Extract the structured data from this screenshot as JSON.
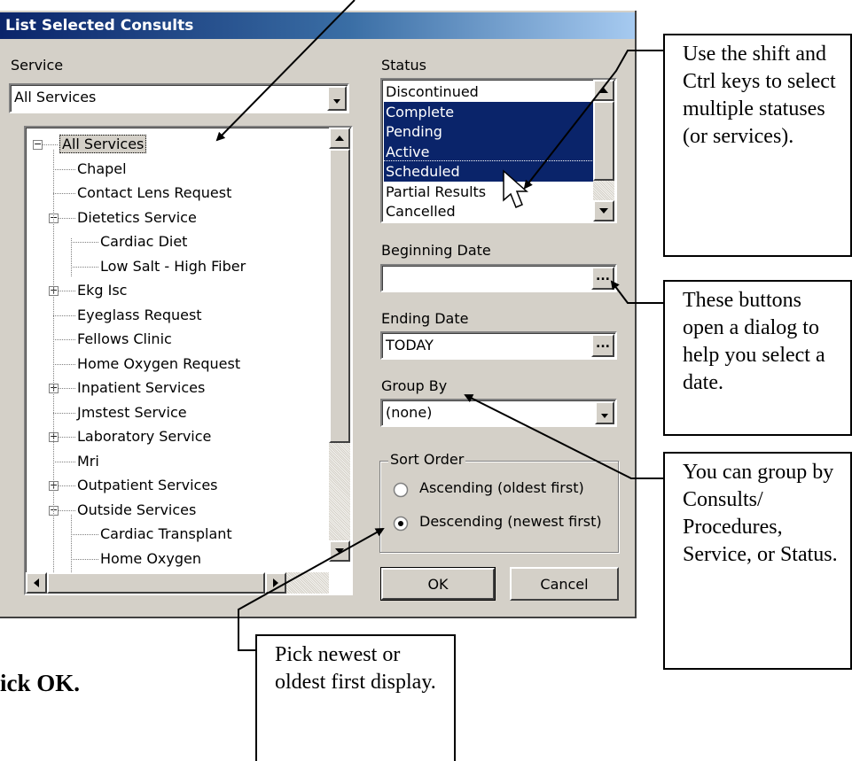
{
  "dialog": {
    "title": "List Selected Consults",
    "service": {
      "label": "Service",
      "value": "All Services",
      "tree": [
        {
          "label": "All Services",
          "level": 0,
          "expander": "−",
          "selected": true
        },
        {
          "label": "Chapel",
          "level": 1
        },
        {
          "label": "Contact Lens Request",
          "level": 1
        },
        {
          "label": "Dietetics Service",
          "level": 1,
          "expander": "−"
        },
        {
          "label": "Cardiac Diet",
          "level": 2
        },
        {
          "label": "Low Salt - High Fiber",
          "level": 2
        },
        {
          "label": "Ekg Isc",
          "level": 1,
          "expander": "+"
        },
        {
          "label": "Eyeglass Request",
          "level": 1
        },
        {
          "label": "Fellows Clinic",
          "level": 1
        },
        {
          "label": "Home Oxygen Request",
          "level": 1
        },
        {
          "label": "Inpatient Services",
          "level": 1,
          "expander": "+"
        },
        {
          "label": "Jmstest Service",
          "level": 1
        },
        {
          "label": "Laboratory Service",
          "level": 1,
          "expander": "+"
        },
        {
          "label": "Mri",
          "level": 1
        },
        {
          "label": "Outpatient Services",
          "level": 1,
          "expander": "+"
        },
        {
          "label": "Outside Services",
          "level": 1,
          "expander": "−"
        },
        {
          "label": "Cardiac Transplant",
          "level": 2
        },
        {
          "label": "Home Oxygen",
          "level": 2
        }
      ]
    },
    "status": {
      "label": "Status",
      "items": [
        {
          "label": "Discontinued",
          "selected": false
        },
        {
          "label": "Complete",
          "selected": true
        },
        {
          "label": "Pending",
          "selected": true
        },
        {
          "label": "Active",
          "selected": true
        },
        {
          "label": "Scheduled",
          "selected": true
        },
        {
          "label": "Partial Results",
          "selected": false
        },
        {
          "label": "Cancelled",
          "selected": false
        }
      ]
    },
    "beginning_date": {
      "label": "Beginning Date",
      "value": "",
      "button": "..."
    },
    "ending_date": {
      "label": "Ending Date",
      "value": "TODAY",
      "button": "..."
    },
    "group_by": {
      "label": "Group By",
      "value": "(none)"
    },
    "sort_order": {
      "label": "Sort Order",
      "ascending": "Ascending (oldest first)",
      "descending": "Descending (newest first)",
      "selected": "descending"
    },
    "ok_label": "OK",
    "cancel_label": "Cancel"
  },
  "callouts": {
    "status_tip": "Use the shift and Ctrl keys to select multiple statuses (or services).",
    "date_tip": "These buttons open a dialog to help you select a date.",
    "group_tip": "You can group by Consults/ Procedures, Service, or Status.",
    "sort_tip": "Pick newest or oldest first display."
  },
  "instruction_text": "ick OK.",
  "colors": {
    "selection": "#0a246a",
    "dialog_bg": "#d4d0c8",
    "title_start": "#0a246a",
    "title_end": "#a6caf0"
  }
}
